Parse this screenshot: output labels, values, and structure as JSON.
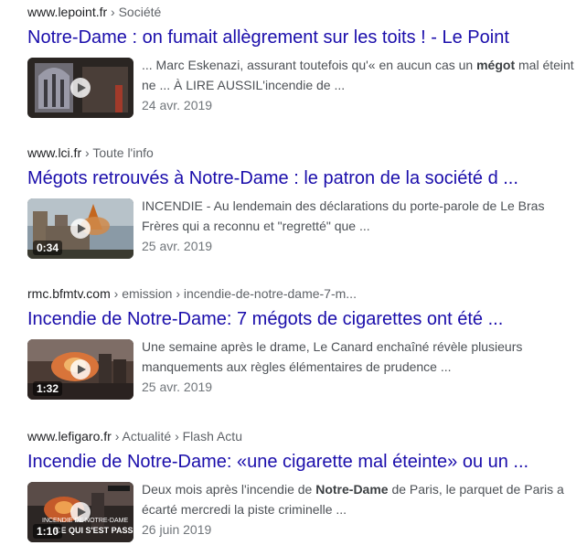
{
  "results": [
    {
      "host": "www.lepoint.fr",
      "crumbs": " › Société",
      "title": "Notre-Dame : on fumait allègrement sur les toits ! - Le Point",
      "snippet_line1_a": "... Marc Eskenazi, assurant toutefois qu'« en aucun cas un ",
      "snippet_line1_b": "mégot",
      "snippet_line1_c": " mal éteint",
      "snippet_line2": "ne ... À LIRE AUSSIL'incendie de ...",
      "date": "24 avr. 2019",
      "duration": ""
    },
    {
      "host": "www.lci.fr",
      "crumbs": " › Toute l'info",
      "title": "Mégots retrouvés à Notre-Dame : le patron de la société d ...",
      "snippet_line1": "INCENDIE - Au lendemain des déclarations du porte-parole de Le Bras",
      "snippet_line2": "Frères qui a reconnu et \"regretté\" que ...",
      "date": "25 avr. 2019",
      "duration": "0:34"
    },
    {
      "host": "rmc.bfmtv.com",
      "crumbs": " › emission › incendie-de-notre-dame-7-m...",
      "title": "Incendie de Notre-Dame: 7 mégots de cigarettes ont été ...",
      "snippet_line1": "Une semaine après le drame, Le Canard enchaîné révèle plusieurs",
      "snippet_line2": "manquements aux règles élémentaires de prudence ...",
      "date": "25 avr. 2019",
      "duration": "1:32"
    },
    {
      "host": "www.lefigaro.fr",
      "crumbs": " › Actualité › Flash Actu",
      "title": "Incendie de Notre-Dame: «une cigarette mal éteinte» ou un ...",
      "snippet_line1_a": "Deux mois après l'incendie de ",
      "snippet_line1_b": "Notre-Dame",
      "snippet_line1_c": " de Paris, le parquet de Paris a",
      "snippet_line2": "écarté mercredi la piste criminelle ...",
      "date": "26 juin 2019",
      "duration": "1:10",
      "thumb_caption_1": "INCENDIE DE NOTRE-DAME",
      "thumb_caption_2": "CE QUI S'EST PASSÉ"
    }
  ]
}
